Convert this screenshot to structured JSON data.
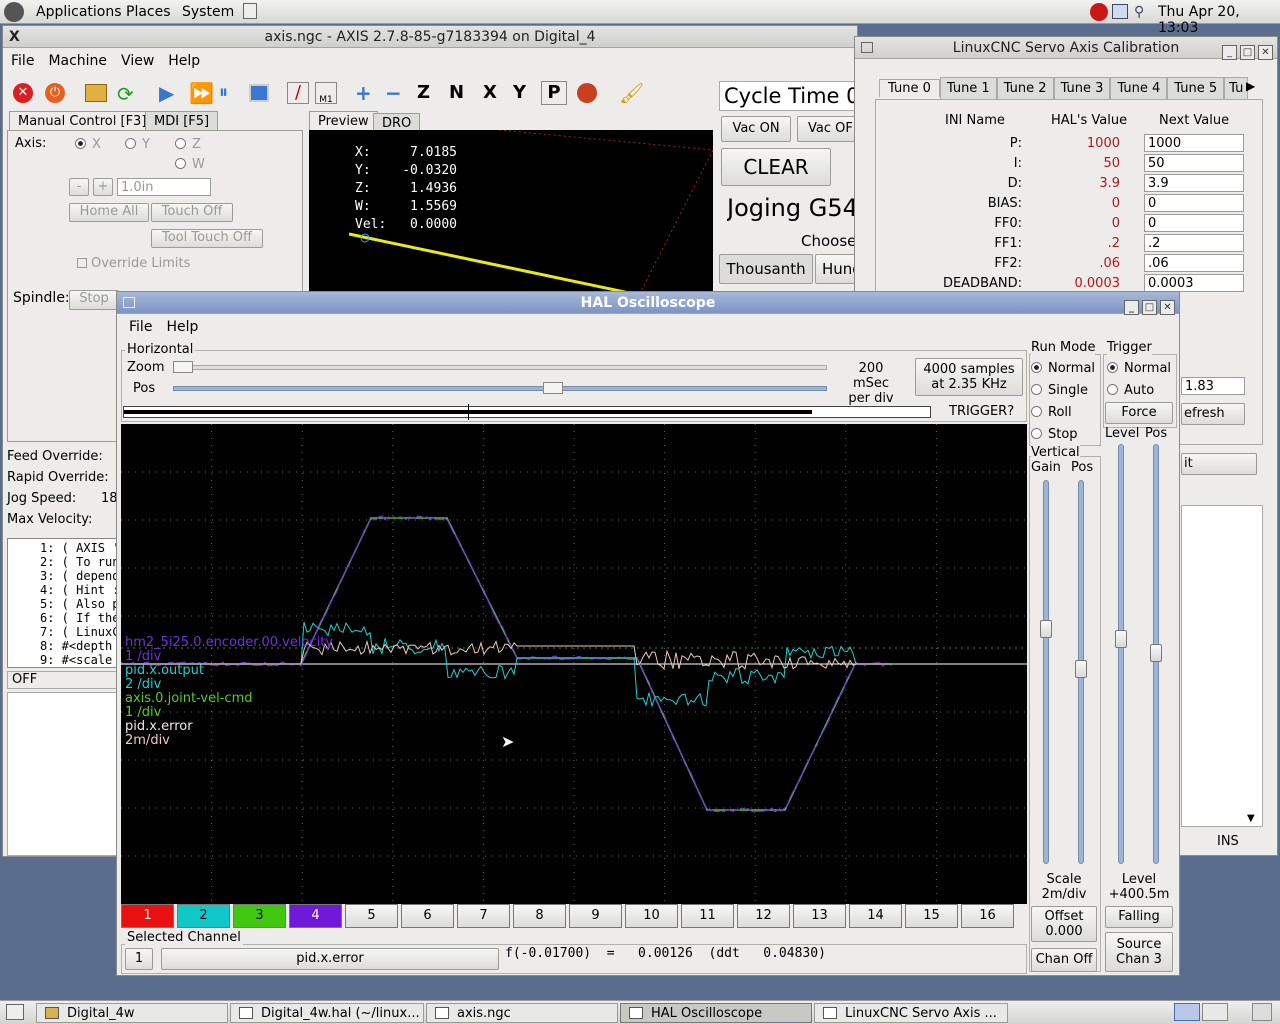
{
  "top_panel": {
    "applications": "Applications",
    "places": "Places",
    "system": "System",
    "clock": "Thu Apr 20, 13:03"
  },
  "axis": {
    "title": "axis.ngc - AXIS 2.7.8-85-g7183394 on Digital_4",
    "menu": [
      "File",
      "Machine",
      "View",
      "Help"
    ],
    "tabs": {
      "manual": "Manual Control [F3]",
      "mdi": "MDI [F5]",
      "preview": "Preview",
      "dro": "DRO"
    },
    "axis_label": "Axis:",
    "axes": [
      "X",
      "Y",
      "Z",
      "W"
    ],
    "minus": "-",
    "plus": "+",
    "increment": "1.0in",
    "home_all": "Home All",
    "touch_off": "Touch Off",
    "tool_touch_off": "Tool Touch Off",
    "override_limits": "Override Limits",
    "spindle_label": "Spindle:",
    "spindle_stop": "Stop",
    "dro": [
      {
        "k": "X:",
        "v": "7.0185"
      },
      {
        "k": "Y:",
        "v": "-0.0320"
      },
      {
        "k": "Z:",
        "v": "1.4936"
      },
      {
        "k": "W:",
        "v": "1.5569"
      },
      {
        "k": "Vel:",
        "v": "0.0000"
      }
    ],
    "cycle_time": "Cycle Time  0",
    "vac_on": "Vac ON",
    "vac_off": "Vac OFF",
    "clear": "CLEAR",
    "joging": "Joging G54",
    "choose": "Choose",
    "thousanth": "Thousanth",
    "hund": "Hund",
    "feed_override": "Feed Override:",
    "rapid_override": "Rapid Override:",
    "jog_speed": "Jog Speed:",
    "jog_speed_value": "18",
    "max_velocity": "Max Velocity:",
    "gcode": [
      "1: ( AXIS '",
      "2: ( To run",
      "3: ( depend",
      "4: ( Hint :",
      "5: ( Also p",
      "6: ( If the",
      "7: ( LinuxC",
      "8: #<depth",
      "9: #<scale"
    ],
    "status": "OFF"
  },
  "cal": {
    "title": "LinuxCNC Servo Axis Calibration",
    "tabs": [
      "Tune 0",
      "Tune 1",
      "Tune 2",
      "Tune 3",
      "Tune 4",
      "Tune 5",
      "Tu"
    ],
    "headers": {
      "ini": "INI Name",
      "hal": "HAL's Value",
      "next": "Next Value"
    },
    "rows": [
      {
        "n": "P:",
        "h": "1000",
        "v": "1000"
      },
      {
        "n": "I:",
        "h": "50",
        "v": "50"
      },
      {
        "n": "D:",
        "h": "3.9",
        "v": "3.9"
      },
      {
        "n": "BIAS:",
        "h": "0",
        "v": "0"
      },
      {
        "n": "FF0:",
        "h": "0",
        "v": "0"
      },
      {
        "n": "FF1:",
        "h": ".2",
        "v": ".2"
      },
      {
        "n": "FF2:",
        "h": ".06",
        "v": ".06"
      },
      {
        "n": "DEADBAND:",
        "h": "0.0003",
        "v": "0.0003"
      }
    ],
    "partial_value": "1.83",
    "refresh": "efresh",
    "it": "it",
    "ins": "INS"
  },
  "scope": {
    "title": "HAL Oscilloscope",
    "menu": [
      "File",
      "Help"
    ],
    "horizontal": "Horizontal",
    "zoom": "Zoom",
    "pos": "Pos",
    "per_div": "200 mSec\nper div",
    "samples": "4000 samples\nat 2.35 KHz",
    "trigger_q": "TRIGGER?",
    "run_mode": "Run Mode",
    "run_opts": [
      "Normal",
      "Single",
      "Roll",
      "Stop"
    ],
    "trigger": "Trigger",
    "trig_opts": [
      "Normal",
      "Auto"
    ],
    "force": "Force",
    "level": "Level",
    "pos2": "Pos",
    "vertical": "Vertical",
    "gain": "Gain",
    "scale": "Scale\n2m/div",
    "offset": "Offset\n0.000",
    "chan_off": "Chan Off",
    "level_val": "Level\n+400.5m",
    "falling": "Falling",
    "source": "Source\nChan  3",
    "channels": [
      "1",
      "2",
      "3",
      "4",
      "5",
      "6",
      "7",
      "8",
      "9",
      "10",
      "11",
      "12",
      "13",
      "14",
      "15",
      "16"
    ],
    "chan_colors": [
      "#e81010",
      "#10c8c8",
      "#40c810",
      "#7018d8"
    ],
    "selected_channel": "Selected Channel",
    "sel_num": "1",
    "sel_name": "pid.x.error",
    "readout": "f(-0.01700)  =   0.00126  (ddt   0.04830)",
    "legend": [
      {
        "n": "hm2_5i25.0.encoder.00.velocity",
        "s": "1 /div",
        "c": "#7030e0"
      },
      {
        "n": "pid.x.output",
        "s": "2 /div",
        "c": "#20d0d0"
      },
      {
        "n": "axis.0.joint-vel-cmd",
        "s": "1 /div",
        "c": "#50d020"
      },
      {
        "n": "pid.x.error",
        "s": "2m/div",
        "c": "#f0c8c0"
      }
    ]
  },
  "taskbar": [
    "Digital_4w",
    "Digital_4w.hal (~/linux...",
    "axis.ngc",
    "HAL Oscilloscope",
    "LinuxCNC Servo Axis ..."
  ]
}
